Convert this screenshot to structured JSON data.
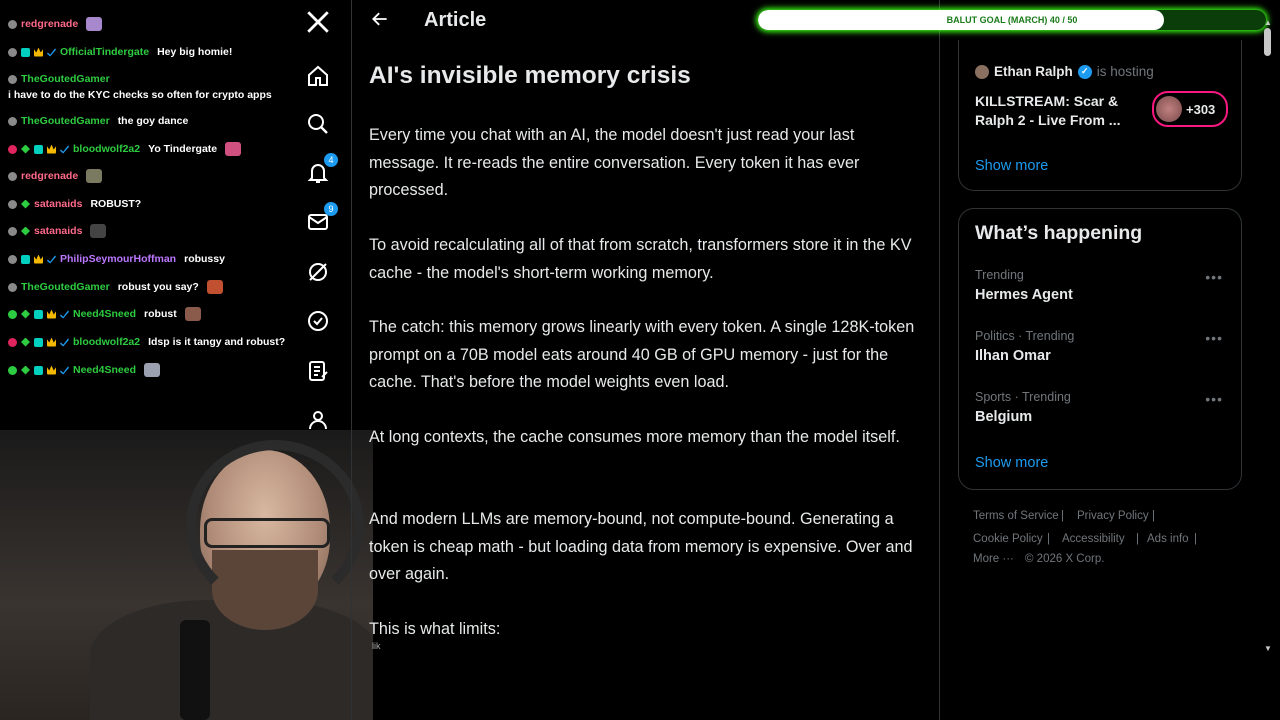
{
  "chat": {
    "lines": [
      {
        "user": "redgrenade",
        "color": "#ff6a8a",
        "badges": [
          "gray"
        ],
        "msg": "",
        "emote": "#a888cc"
      },
      {
        "user": "OfficialTindergate",
        "color": "#2ecc40",
        "badges": [
          "gray",
          "grid",
          "crown",
          "check"
        ],
        "msg": "Hey big homie!"
      },
      {
        "user": "TheGoutedGamer",
        "color": "#2ecc40",
        "badges": [
          "gray"
        ],
        "msg": ""
      },
      {
        "user": "TheGoutedGamer",
        "color": "#2ecc40",
        "badges": [
          "gray"
        ],
        "msg": "the goy dance"
      },
      {
        "user": "bloodwolf2a2",
        "color": "#2ecc40",
        "badges": [
          "red",
          "diamond",
          "grid",
          "crown",
          "check"
        ],
        "msg": "Yo Tindergate",
        "emote": "#d05080"
      },
      {
        "user": "redgrenade",
        "color": "#ff6a8a",
        "badges": [
          "gray"
        ],
        "msg": "",
        "emote": "#7a7a60"
      },
      {
        "user": "satanaids",
        "color": "#ff6a8a",
        "badges": [
          "gray",
          "diamond"
        ],
        "msg": "ROBUST?"
      },
      {
        "user": "satanaids",
        "color": "#ff6a8a",
        "badges": [
          "gray",
          "diamond"
        ],
        "msg": "",
        "emote": "#444"
      },
      {
        "user": "PhilipSeymourHoffman",
        "color": "#bb77ff",
        "badges": [
          "gray",
          "grid",
          "crown",
          "check"
        ],
        "msg": "robussy"
      },
      {
        "user": "TheGoutedGamer",
        "color": "#2ecc40",
        "badges": [
          "gray"
        ],
        "msg": "robust you say?",
        "emote": "#c05030"
      },
      {
        "user": "Need4Sneed",
        "color": "#2ecc40",
        "badges": [
          "green",
          "diamond",
          "grid",
          "crown",
          "check"
        ],
        "msg": "robust",
        "emote": "#8a5a4a"
      },
      {
        "user": "bloodwolf2a2",
        "color": "#2ecc40",
        "badges": [
          "red",
          "diamond",
          "grid",
          "crown",
          "check"
        ],
        "msg": "Idsp is it tangy and robust?"
      },
      {
        "user": "Need4Sneed",
        "color": "#2ecc40",
        "badges": [
          "green",
          "diamond",
          "grid",
          "crown",
          "check"
        ],
        "msg": "",
        "emote": "#9aa0b0"
      }
    ],
    "full_line": "i have to do the KYC checks so often for crypto apps"
  },
  "nav": {
    "items": [
      "x-logo-icon",
      "home-icon",
      "search-icon",
      "notifications-icon",
      "messages-icon",
      "grok-icon",
      "verified-icon",
      "articles-icon",
      "profile-icon"
    ],
    "notifications_badge": "4",
    "messages_badge": "9"
  },
  "header": {
    "title": "Article"
  },
  "article": {
    "title": "AI's invisible memory crisis",
    "paragraphs": [
      "Every time you chat with an AI, the model doesn't just read your last message. It re-reads the entire conversation. Every token it has ever processed.",
      "To avoid recalculating all of that from scratch, transformers store it in the KV cache - the model's short-term working memory.",
      "The catch: this memory grows linearly with every token. A single 128K-token prompt on a 70B model eats around 40 GB of GPU memory - just for the cache. That's before the model weights even load.",
      "At long contexts, the cache consumes more memory than the model itself.",
      "And modern LLMs are memory-bound, not compute-bound. Generating a token is cheap math - but loading data from memory is expensive. Over and over again.",
      "This is what limits:"
    ],
    "overlay_text": "lik"
  },
  "goal": {
    "label": "BALUT GOAL (MARCH) 40 / 50",
    "progress": 0.8,
    "accent": "#39ff14"
  },
  "space": {
    "host": "Ethan Ralph",
    "hosting_text": "is hosting",
    "title": "KILLSTREAM: Scar & Ralph 2 - Live From ...",
    "listener_count": "+303",
    "show_more": "Show more"
  },
  "trends": {
    "title": "What’s happening",
    "items": [
      {
        "meta": "Trending",
        "name": "Hermes Agent"
      },
      {
        "meta": "Politics · Trending",
        "name": "Ilhan Omar"
      },
      {
        "meta": "Sports · Trending",
        "name": "Belgium"
      }
    ],
    "show_more": "Show more"
  },
  "footer": {
    "terms": "Terms of Service",
    "privacy": "Privacy Policy",
    "cookie": "Cookie Policy",
    "accessibility": "Accessibility",
    "ads": "Ads info",
    "more": "More ···",
    "copyright": "© 2026 X Corp."
  }
}
